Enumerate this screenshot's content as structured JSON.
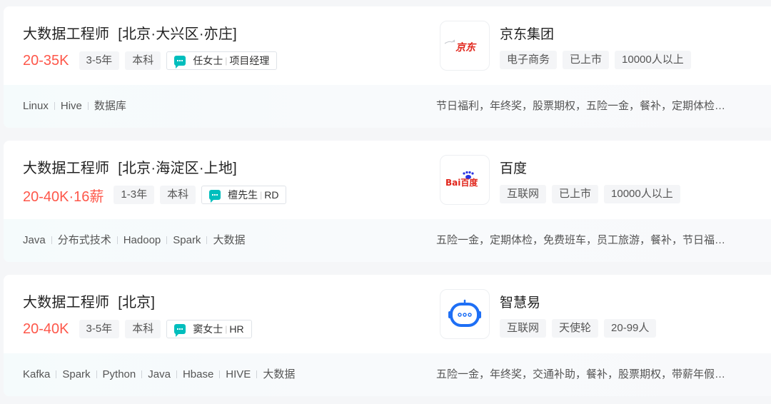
{
  "jobs": [
    {
      "title": "大数据工程师",
      "location": "[北京·大兴区·亦庄]",
      "salary": "20-35K",
      "tags": [
        "3-5年",
        "本科"
      ],
      "recruiter": {
        "name": "任女士",
        "role": "项目经理"
      },
      "company": {
        "name": "京东集团",
        "logo_text": "京东",
        "tags": [
          "电子商务",
          "已上市",
          "10000人以上"
        ]
      },
      "skills": [
        "Linux",
        "Hive",
        "数据库"
      ],
      "welfare": "节日福利，年终奖，股票期权，五险一金，餐补，定期体检…"
    },
    {
      "title": "大数据工程师",
      "location": "[北京·海淀区·上地]",
      "salary": "20-40K·16薪",
      "tags": [
        "1-3年",
        "本科"
      ],
      "recruiter": {
        "name": "檀先生",
        "role": "RD"
      },
      "company": {
        "name": "百度",
        "logo_text": "Bai百度",
        "tags": [
          "互联网",
          "已上市",
          "10000人以上"
        ]
      },
      "skills": [
        "Java",
        "分布式技术",
        "Hadoop",
        "Spark",
        "大数据"
      ],
      "welfare": "五险一金，定期体检，免费班车，员工旅游，餐补，节日福…"
    },
    {
      "title": "大数据工程师",
      "location": "[北京]",
      "salary": "20-40K",
      "tags": [
        "3-5年",
        "本科"
      ],
      "recruiter": {
        "name": "窦女士",
        "role": "HR"
      },
      "company": {
        "name": "智慧易",
        "logo_text": "",
        "tags": [
          "互联网",
          "天使轮",
          "20-99人"
        ]
      },
      "skills": [
        "Kafka",
        "Spark",
        "Python",
        "Java",
        "Hbase",
        "HIVE",
        "大数据"
      ],
      "welfare": "五险一金，年终奖，交通补助，餐补，股票期权，带薪年假…"
    }
  ],
  "colors": {
    "salary": "#fe574a",
    "chat": "#00bebd",
    "jd_red": "#e1251b",
    "baidu_blue": "#2932e1",
    "zhihuiyi_blue": "#1e6ff5"
  },
  "icons": {
    "chat": "chat-bubble-icon"
  }
}
